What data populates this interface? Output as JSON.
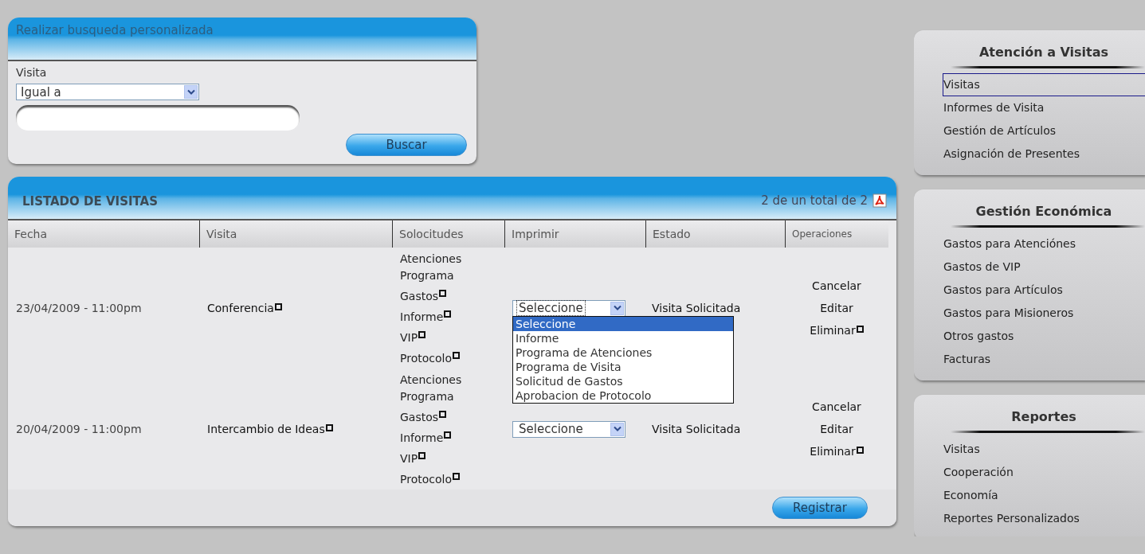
{
  "search_panel": {
    "title": "Realizar busqueda personalizada",
    "field_label": "Visita",
    "operator_select": {
      "value": "Igual a"
    },
    "button": "Buscar"
  },
  "listing": {
    "title": "LISTADO DE VISITAS",
    "count": "2 de un total de 2",
    "columns": [
      {
        "label": "Fecha",
        "kind": "normal"
      },
      {
        "label": "Visita",
        "kind": "normal"
      },
      {
        "label": "Solocitudes",
        "kind": "normal"
      },
      {
        "label": "Imprimir",
        "kind": "normal"
      },
      {
        "label": "Estado",
        "kind": "normal"
      },
      {
        "label": "Operaciones",
        "kind": "small"
      }
    ],
    "rows": [
      {
        "fecha": "23/04/2009 - 11:00pm",
        "visita": {
          "text": "Conferencia",
          "marked": true
        },
        "solicitudes": [
          {
            "text": "Atenciones Programa",
            "marked": false
          },
          {
            "text": "Gastos",
            "marked": true
          },
          {
            "text": "Informe",
            "marked": true
          },
          {
            "text": "VIP",
            "marked": true
          },
          {
            "text": "Protocolo",
            "marked": true
          }
        ],
        "imprimir": {
          "value": "Seleccione",
          "open": true,
          "options": [
            {
              "label": "Seleccione",
              "selected": true
            },
            {
              "label": "Informe",
              "selected": false
            },
            {
              "label": "Programa de Atenciones",
              "selected": false
            },
            {
              "label": "Programa de Visita",
              "selected": false
            },
            {
              "label": "Solicitud de Gastos",
              "selected": false
            },
            {
              "label": "Aprobacion de Protocolo",
              "selected": false
            }
          ]
        },
        "estado": "Visita Solicitada",
        "operations": [
          {
            "label": "Cancelar",
            "marked": false
          },
          {
            "label": "Editar",
            "marked": false
          },
          {
            "label": "Eliminar",
            "marked": true
          }
        ]
      },
      {
        "fecha": "20/04/2009 - 11:00pm",
        "visita": {
          "text": "Intercambio de Ideas",
          "marked": true
        },
        "solicitudes": [
          {
            "text": "Atenciones Programa",
            "marked": false
          },
          {
            "text": "Gastos",
            "marked": true
          },
          {
            "text": "Informe",
            "marked": true
          },
          {
            "text": "VIP",
            "marked": true
          },
          {
            "text": "Protocolo",
            "marked": true
          }
        ],
        "imprimir": {
          "value": "Seleccione",
          "open": false
        },
        "estado": "Visita Solicitada",
        "operations": [
          {
            "label": "Cancelar",
            "marked": false
          },
          {
            "label": "Editar",
            "marked": false
          },
          {
            "label": "Eliminar",
            "marked": true
          }
        ]
      }
    ],
    "footer_button": "Registrar"
  },
  "sidebar": [
    {
      "title": "Atención a Visitas",
      "items": [
        {
          "label": "Visitas",
          "selected": true
        },
        {
          "label": "Informes de Visita",
          "selected": false
        },
        {
          "label": "Gestión de Artículos",
          "selected": false
        },
        {
          "label": "Asignación de Presentes",
          "selected": false
        }
      ]
    },
    {
      "title": "Gestión Económica",
      "items": [
        {
          "label": "Gastos para Atenciónes",
          "selected": false
        },
        {
          "label": "Gastos de VIP",
          "selected": false
        },
        {
          "label": "Gastos para Artículos",
          "selected": false
        },
        {
          "label": "Gastos para Misioneros",
          "selected": false
        },
        {
          "label": "Otros gastos",
          "selected": false
        },
        {
          "label": "Facturas",
          "selected": false
        }
      ]
    },
    {
      "title": "Reportes",
      "items": [
        {
          "label": "Visitas",
          "selected": false
        },
        {
          "label": "Cooperación",
          "selected": false
        },
        {
          "label": "Economía",
          "selected": false
        },
        {
          "label": "Reportes Personalizados",
          "selected": false
        }
      ]
    }
  ]
}
